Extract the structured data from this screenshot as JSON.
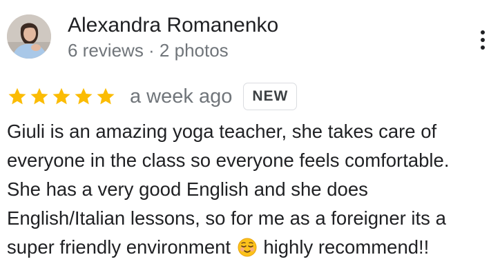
{
  "review": {
    "author": {
      "name": "Alexandra Romanenko",
      "meta": "6 reviews · 2 photos"
    },
    "rating": {
      "stars": 5,
      "max_stars": 5,
      "color": "#fbbc04"
    },
    "time_ago": "a week ago",
    "badge": "NEW",
    "text_lines": [
      "Giuli is an amazing yoga teacher, she takes care of",
      "everyone in the class so everyone feels comfortable.",
      "She has a very good English and she does",
      "English/Italian lessons, so for me as a foreigner its a"
    ],
    "last_line_before": "super friendly environment",
    "emoji": "relieved-face-emoji",
    "last_line_after": "highly recommend!!"
  },
  "icons": {
    "more_options": "vertical-ellipsis-icon",
    "star": "star-icon"
  }
}
